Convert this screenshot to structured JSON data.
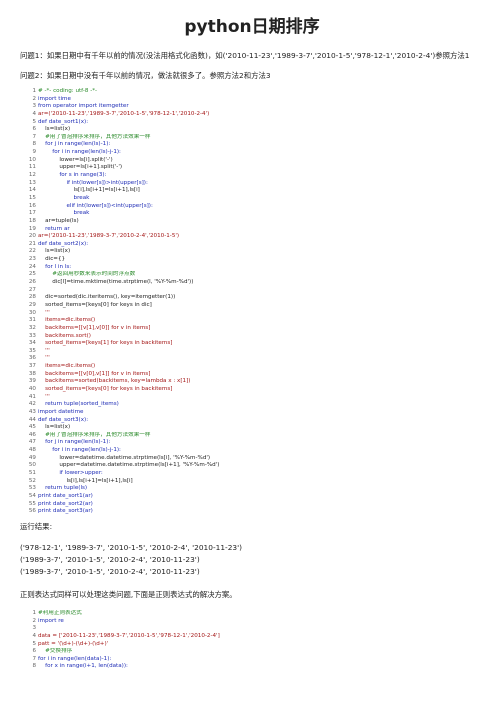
{
  "title": "python日期排序",
  "intro": [
    "问题1：如果日期中有千年以前的情况(没法用格式化函数)，如('2010-11-23','1989-3-7','2010-1-5','978-12-1','2010-2-4')参照方法1",
    "问题2：如果日期中没有千年以前的情况，做法就很多了。参照方法2和方法3"
  ],
  "code1": [
    {
      "n": "1",
      "t": "# -*- coding: utf-8 -*-",
      "c": "cm"
    },
    {
      "n": "2",
      "t": "import time",
      "c": "kw"
    },
    {
      "n": "3",
      "t": "from operator import itemgetter",
      "c": "kw"
    },
    {
      "n": "4",
      "t": "ar=('2010-11-23','1989-3-7','2010-1-5','978-12-1','2010-2-4')",
      "c": "str"
    },
    {
      "n": "5",
      "t": "def date_sort1(x):",
      "c": "kw"
    },
    {
      "n": "6",
      "t": "    ls=list(x)",
      "c": ""
    },
    {
      "n": "7",
      "t": "    #用了冒泡排序来排序，其他方法效果一样",
      "c": "cm"
    },
    {
      "n": "8",
      "t": "    for j in range(len(ls)-1):",
      "c": "kw"
    },
    {
      "n": "9",
      "t": "        for i in range(len(ls)-j-1):",
      "c": "kw"
    },
    {
      "n": "10",
      "t": "            lower=ls[i].split('-')",
      "c": ""
    },
    {
      "n": "11",
      "t": "            upper=ls[i+1].split('-')",
      "c": ""
    },
    {
      "n": "12",
      "t": "            for s in range(3):",
      "c": "kw"
    },
    {
      "n": "13",
      "t": "                if int(lower[s])>int(upper[s]):",
      "c": "kw"
    },
    {
      "n": "14",
      "t": "                    ls[i],ls[i+1]=ls[i+1],ls[i]",
      "c": ""
    },
    {
      "n": "15",
      "t": "                    break",
      "c": "kw"
    },
    {
      "n": "16",
      "t": "                elif int(lower[s])<int(upper[s]):",
      "c": "kw"
    },
    {
      "n": "17",
      "t": "                    break",
      "c": "kw"
    },
    {
      "n": "18",
      "t": "    ar=tuple(ls)",
      "c": ""
    },
    {
      "n": "19",
      "t": "    return ar",
      "c": "kw"
    },
    {
      "n": "20",
      "t": "ar=('2010-11-23','1989-3-7','2010-2-4','2010-1-5')",
      "c": "str"
    },
    {
      "n": "21",
      "t": "def date_sort2(x):",
      "c": "kw"
    },
    {
      "n": "22",
      "t": "    ls=list(x)",
      "c": ""
    },
    {
      "n": "23",
      "t": "    dic={}",
      "c": ""
    },
    {
      "n": "24",
      "t": "    for l in ls:",
      "c": "kw"
    },
    {
      "n": "25",
      "t": "        #返回用秒数来表示时间的浮点数",
      "c": "cm"
    },
    {
      "n": "26",
      "t": "        dic[l]=time.mktime(time.strptime(l, '%Y-%m-%d'))",
      "c": ""
    },
    {
      "n": "27",
      "t": "",
      "c": ""
    },
    {
      "n": "28",
      "t": "    dic=sorted(dic.iteritems(), key=itemgetter(1))",
      "c": ""
    },
    {
      "n": "29",
      "t": "    sorted_items=[keys[0] for keys in dic]",
      "c": ""
    },
    {
      "n": "30",
      "t": "    '''",
      "c": "str"
    },
    {
      "n": "31",
      "t": "    items=dic.items()",
      "c": "str"
    },
    {
      "n": "32",
      "t": "    backitems=[[v[1],v[0]] for v in items]",
      "c": "str"
    },
    {
      "n": "33",
      "t": "    backitems.sort()",
      "c": "str"
    },
    {
      "n": "34",
      "t": "    sorted_items=[keys[1] for keys in backitems]",
      "c": "str"
    },
    {
      "n": "35",
      "t": "    '''",
      "c": "str"
    },
    {
      "n": "36",
      "t": "    '''",
      "c": "str"
    },
    {
      "n": "37",
      "t": "    items=dic.items()",
      "c": "str"
    },
    {
      "n": "38",
      "t": "    backitems=[[v[0],v[1]] for v in items]",
      "c": "str"
    },
    {
      "n": "39",
      "t": "    backitems=sorted(backitems, key=lambda x : x[1])",
      "c": "str"
    },
    {
      "n": "40",
      "t": "    sorted_items=[keys[0] for keys in backitems]",
      "c": "str"
    },
    {
      "n": "41",
      "t": "    '''",
      "c": "str"
    },
    {
      "n": "42",
      "t": "    return tuple(sorted_items)",
      "c": "kw"
    },
    {
      "n": "43",
      "t": "import datetime",
      "c": "kw"
    },
    {
      "n": "44",
      "t": "def date_sort3(x):",
      "c": "kw"
    },
    {
      "n": "45",
      "t": "    ls=list(x)",
      "c": ""
    },
    {
      "n": "46",
      "t": "    #用了冒泡排序来排序，其他方法效果一样",
      "c": "cm"
    },
    {
      "n": "47",
      "t": "    for j in range(len(ls)-1):",
      "c": "kw"
    },
    {
      "n": "48",
      "t": "        for i in range(len(ls)-j-1):",
      "c": "kw"
    },
    {
      "n": "49",
      "t": "            lower=datetime.datetime.strptime(ls[i], '%Y-%m-%d')",
      "c": ""
    },
    {
      "n": "50",
      "t": "            upper=datetime.datetime.strptime(ls[i+1], '%Y-%m-%d')",
      "c": ""
    },
    {
      "n": "51",
      "t": "            if lower>upper:",
      "c": "kw"
    },
    {
      "n": "52",
      "t": "                ls[i],ls[i+1]=ls[i+1],ls[i]",
      "c": ""
    },
    {
      "n": "53",
      "t": "    return tuple(ls)",
      "c": "kw"
    },
    {
      "n": "54",
      "t": "print date_sort1(ar)",
      "c": "kw"
    },
    {
      "n": "55",
      "t": "print date_sort2(ar)",
      "c": "kw"
    },
    {
      "n": "56",
      "t": "print date_sort3(ar)",
      "c": "kw"
    }
  ],
  "result_heading": "运行结果:",
  "results": [
    "('978-12-1', '1989-3-7', '2010-1-5', '2010-2-4', '2010-11-23')",
    "('1989-3-7', '2010-1-5', '2010-2-4', '2010-11-23')",
    "('1989-3-7', '2010-1-5', '2010-2-4', '2010-11-23')"
  ],
  "regex_note": "正则表达式同样可以处理这类问题,下面是正则表达式的解决方案。",
  "code2": [
    {
      "n": "1",
      "t": "#利用正则表达式",
      "c": "cm"
    },
    {
      "n": "2",
      "t": "import re",
      "c": "kw"
    },
    {
      "n": "3",
      "t": "",
      "c": ""
    },
    {
      "n": "4",
      "t": "data = ['2010-11-23','1989-3-7','2010-1-5','978-12-1','2010-2-4']",
      "c": "str"
    },
    {
      "n": "5",
      "t": "patt = '(\\d+)-(\\d+)-(\\d+)'",
      "c": "str"
    },
    {
      "n": "6",
      "t": "    #交换排序",
      "c": "cm"
    },
    {
      "n": "7",
      "t": "for i in range(len(data)-1):",
      "c": "kw"
    },
    {
      "n": "8",
      "t": "    for x in range(i+1, len(data)):",
      "c": "kw"
    }
  ]
}
